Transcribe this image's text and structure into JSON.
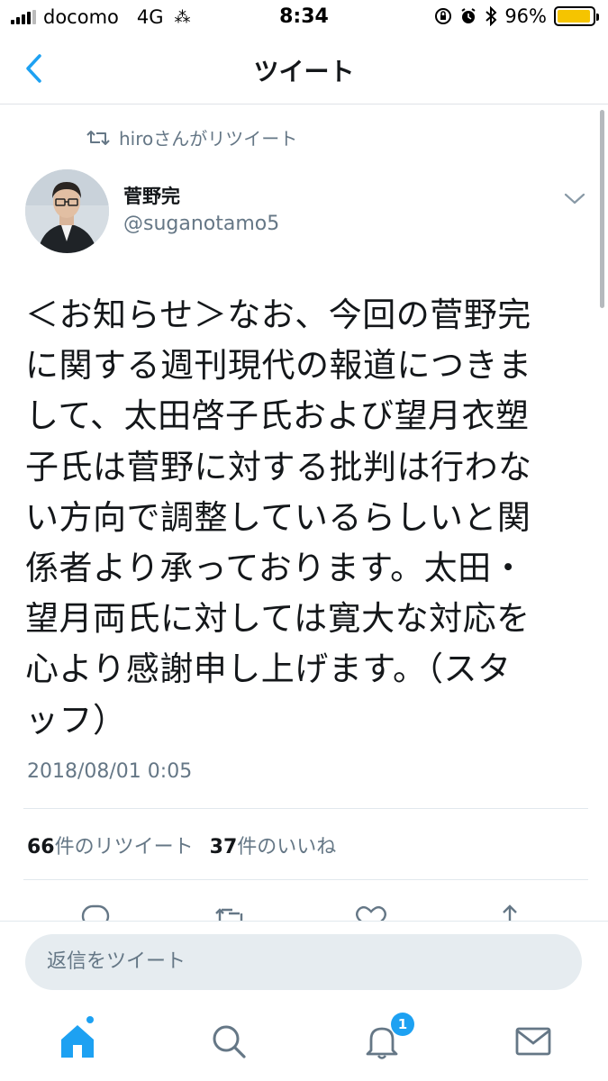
{
  "status_bar": {
    "carrier": "docomo",
    "network": "4G",
    "time": "8:34",
    "battery": "96%",
    "battery_level": 0.96
  },
  "nav": {
    "back_icon": "chevron-left-icon",
    "title": "ツイート"
  },
  "tweet": {
    "retweeted_by": "hiroさんがリツイート",
    "author_name": "菅野完",
    "author_handle": "@suganotamo5",
    "lines": [
      "＜お知らせ＞なお、今回の菅野完",
      "に関する週刊現代の報道につきま",
      "して、太田啓子氏および望月衣塑",
      "子氏は菅野に対する批判は行わな",
      "い方向で調整しているらしいと関",
      "係者より承っております。太田・",
      "望月両氏に対しては寛大な対応を",
      "心より感謝申し上げます。（スタ",
      "ッフ）"
    ],
    "timestamp": "2018/08/01 0:05",
    "retweet_count": "66",
    "retweet_label": "件のリツイート",
    "like_count": "37",
    "like_label": "件のいいね"
  },
  "reply_bar": {
    "placeholder": "返信をツイート"
  },
  "tab_bar": {
    "notifications_badge": "1"
  },
  "colors": {
    "accent": "#1da1f2",
    "secondary_text": "#657786",
    "primary_text": "#14171a"
  }
}
